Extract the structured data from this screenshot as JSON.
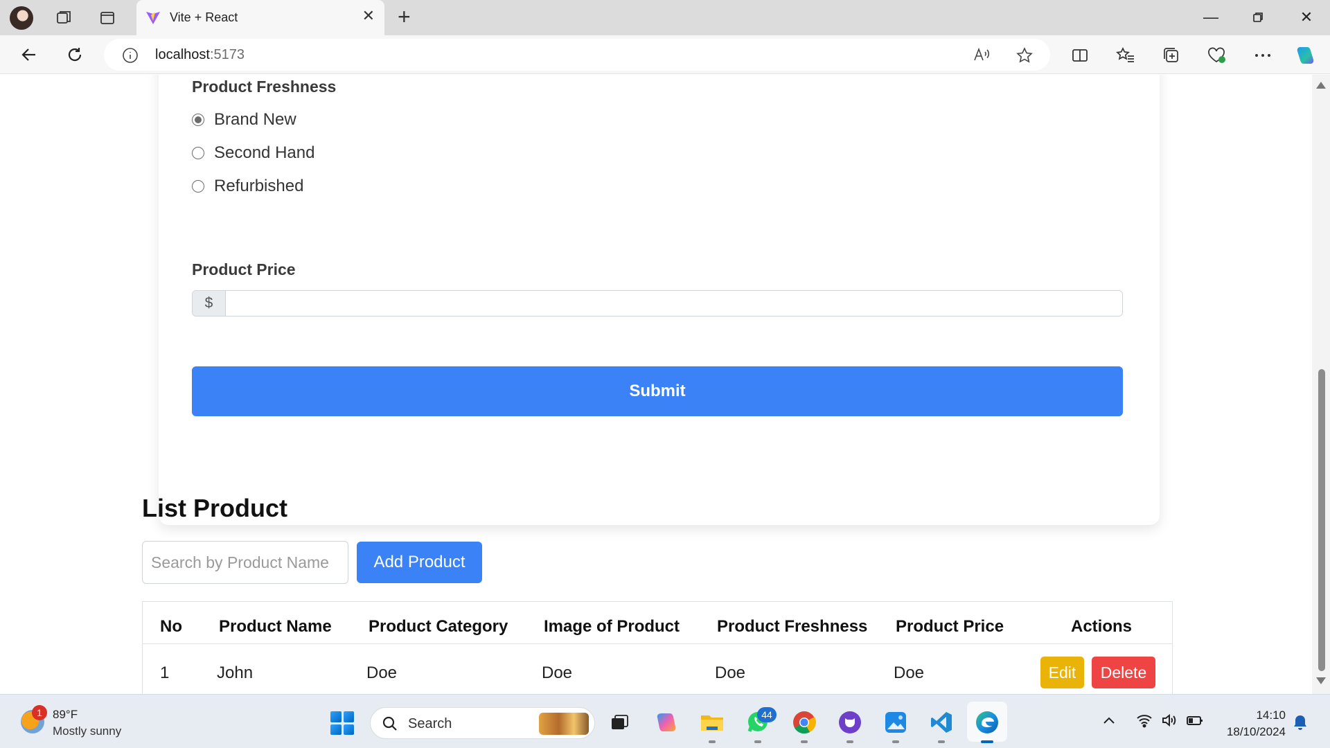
{
  "browser": {
    "tab_title": "Vite + React",
    "url_host": "localhost",
    "url_port": ":5173"
  },
  "form": {
    "freshness_label": "Product Freshness",
    "freshness_options": [
      "Brand New",
      "Second Hand",
      "Refurbished"
    ],
    "freshness_selected": "Brand New",
    "price_label": "Product Price",
    "price_prefix": "$",
    "price_value": "",
    "submit_label": "Submit"
  },
  "list": {
    "title": "List Product",
    "search_placeholder": "Search by Product Name",
    "add_button": "Add Product",
    "columns": [
      "No",
      "Product Name",
      "Product Category",
      "Image of Product",
      "Product Freshness",
      "Product Price",
      "Actions"
    ],
    "rows": [
      {
        "no": "1",
        "name": "John",
        "category": "Doe",
        "image": "Doe",
        "freshness": "Doe",
        "price": "Doe"
      }
    ],
    "edit_label": "Edit",
    "delete_label": "Delete"
  },
  "taskbar": {
    "weather_badge": "1",
    "weather_temp": "89°F",
    "weather_desc": "Mostly sunny",
    "search_text": "Search",
    "whatsapp_badge": "44",
    "time": "14:10",
    "date": "18/10/2024"
  },
  "colors": {
    "primary": "#3b82f6",
    "edit": "#eab308",
    "delete": "#ef4444"
  }
}
